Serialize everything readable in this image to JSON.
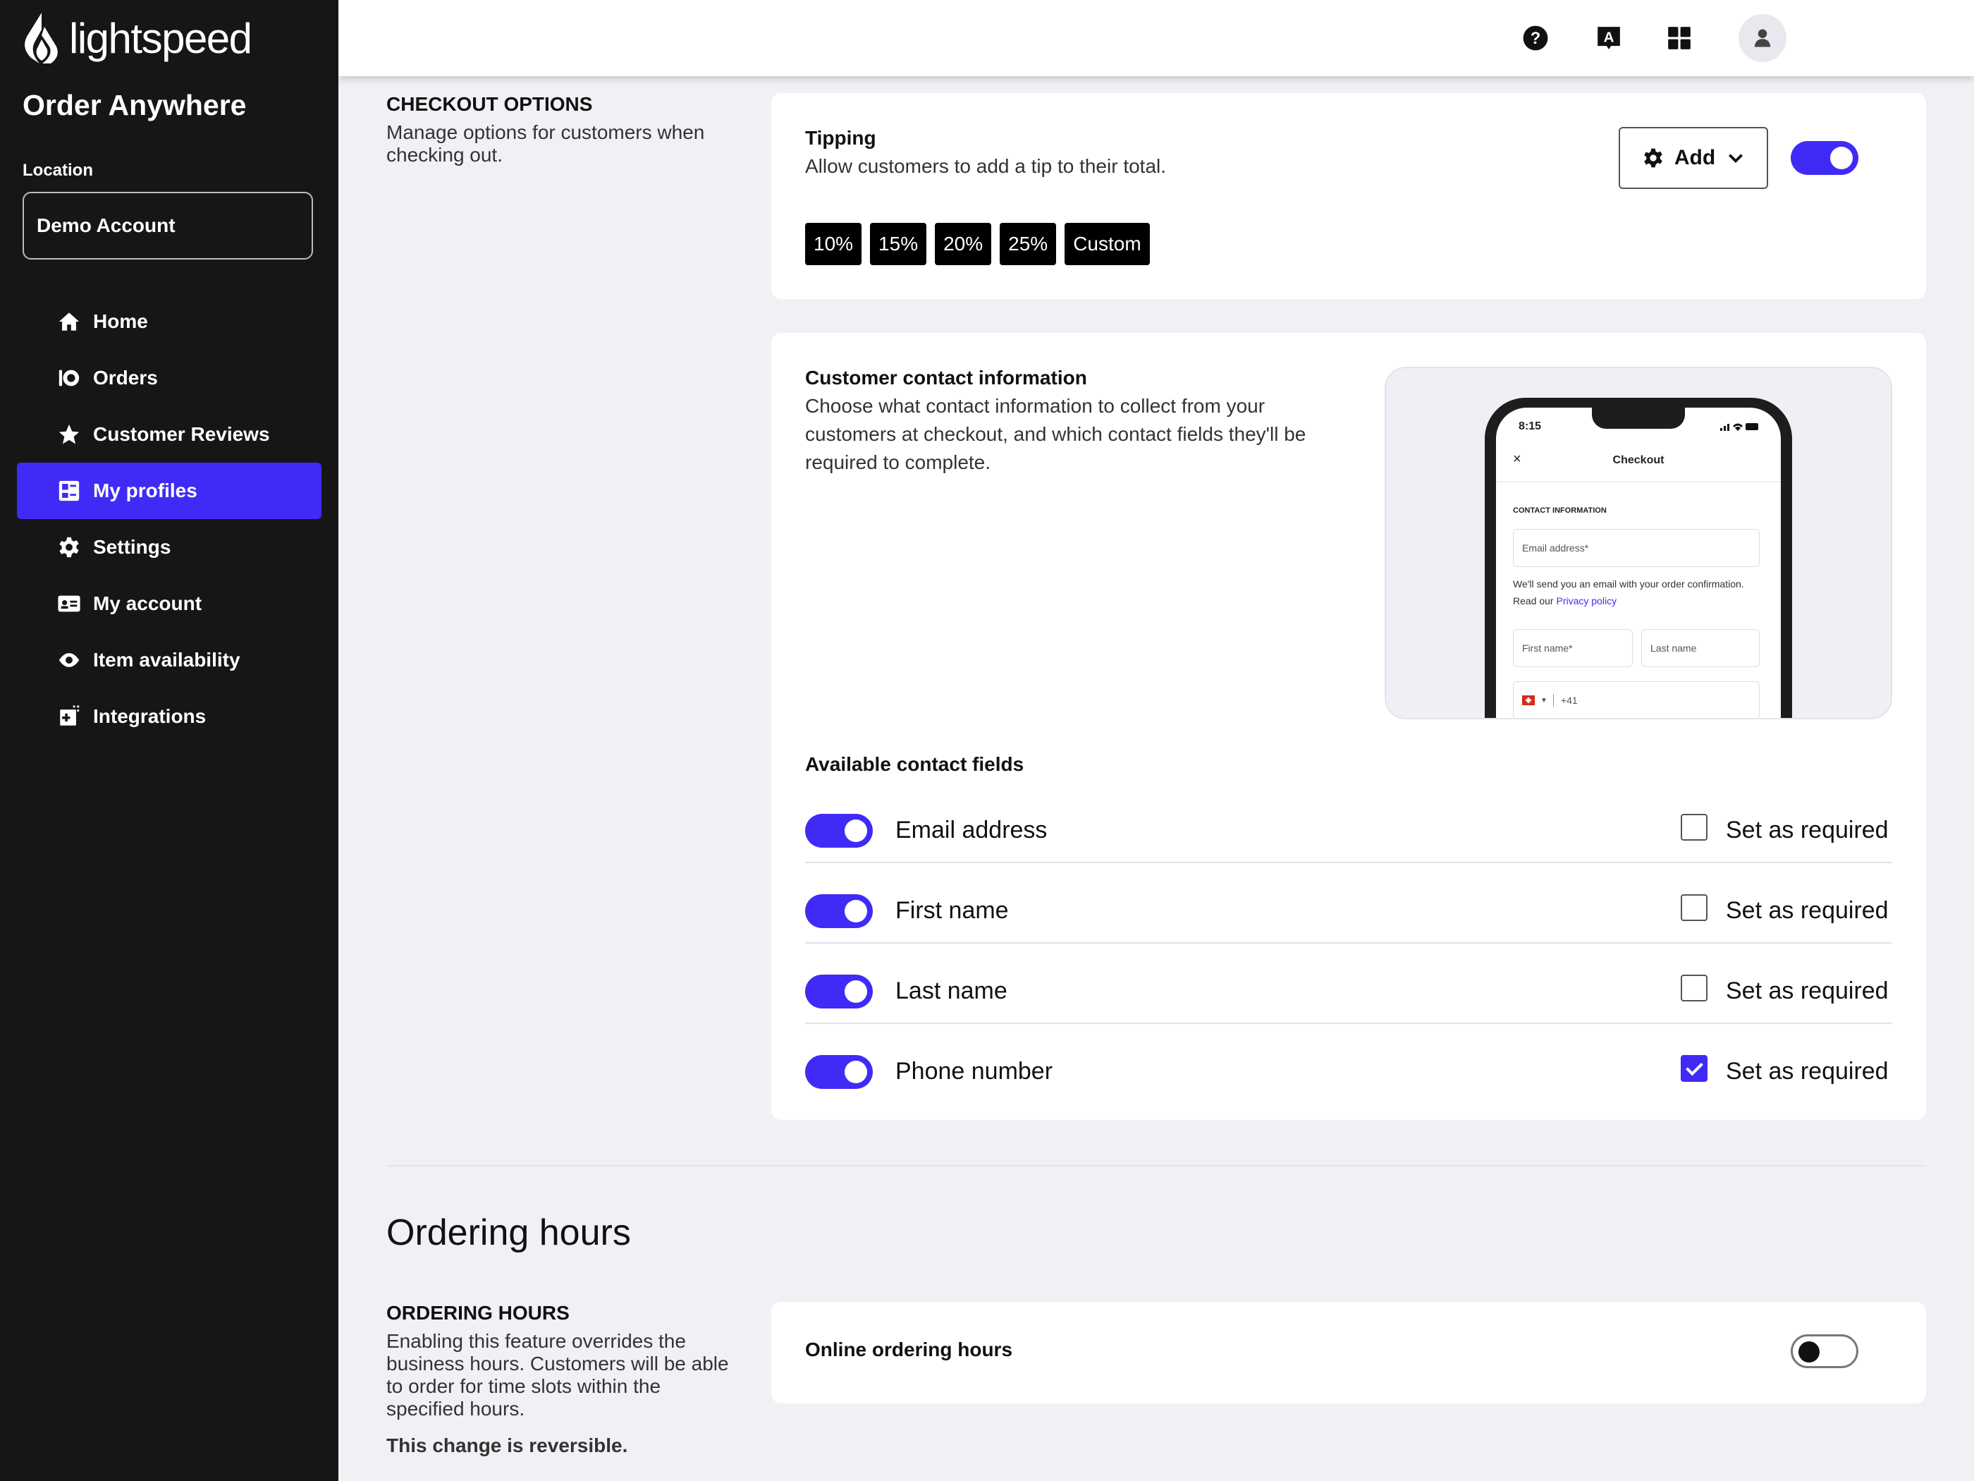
{
  "sidebar": {
    "brand": "lightspeed",
    "app_title": "Order Anywhere",
    "location_label": "Location",
    "location_value": "Demo Account",
    "nav": [
      {
        "label": "Home",
        "icon": "home-icon"
      },
      {
        "label": "Orders",
        "icon": "orders-icon"
      },
      {
        "label": "Customer Reviews",
        "icon": "star-icon"
      },
      {
        "label": "My profiles",
        "icon": "profiles-icon",
        "active": true
      },
      {
        "label": "Settings",
        "icon": "gear-icon"
      },
      {
        "label": "My account",
        "icon": "id-card-icon"
      },
      {
        "label": "Item availability",
        "icon": "eye-icon"
      },
      {
        "label": "Integrations",
        "icon": "integrations-icon"
      }
    ]
  },
  "topbar": {
    "icons": [
      "help-icon",
      "language-icon",
      "apps-grid-icon",
      "user-icon"
    ],
    "language_glyph": "A"
  },
  "checkout": {
    "heading": "CHECKOUT OPTIONS",
    "description": "Manage options for customers when checking out.",
    "tipping": {
      "title": "Tipping",
      "description": "Allow customers to add a tip to their total.",
      "add_label": "Add",
      "enabled": true,
      "chips": [
        "10%",
        "15%",
        "20%",
        "25%",
        "Custom"
      ]
    },
    "contact": {
      "title": "Customer contact information",
      "description": "Choose what contact information to collect from your customers at checkout, and which contact fields they'll be required to complete.",
      "fields_heading": "Available contact fields",
      "required_label": "Set as required",
      "fields": [
        {
          "label": "Email address",
          "enabled": true,
          "required": false
        },
        {
          "label": "First name",
          "enabled": true,
          "required": false
        },
        {
          "label": "Last name",
          "enabled": true,
          "required": false
        },
        {
          "label": "Phone number",
          "enabled": true,
          "required": true
        }
      ],
      "preview": {
        "time": "8:15",
        "close": "×",
        "title": "Checkout",
        "section": "CONTACT INFORMATION",
        "email_placeholder": "Email address*",
        "note": "We'll send you an email with your order confirmation. Read our",
        "note_link": "Privacy policy",
        "first_name_placeholder": "First name*",
        "last_name_placeholder": "Last name",
        "phone_prefix": "+41"
      }
    }
  },
  "ordering_hours": {
    "title": "Ordering hours",
    "heading": "ORDERING HOURS",
    "description": "Enabling this feature overrides the business hours. Customers will be able to order for time slots within the specified hours.",
    "reversible_note": "This change is reversible.",
    "online_label": "Online ordering hours",
    "online_enabled": false
  },
  "colors": {
    "accent": "#3f2bf5",
    "sidebar_bg": "#161616",
    "page_bg": "#f1f1f5"
  }
}
